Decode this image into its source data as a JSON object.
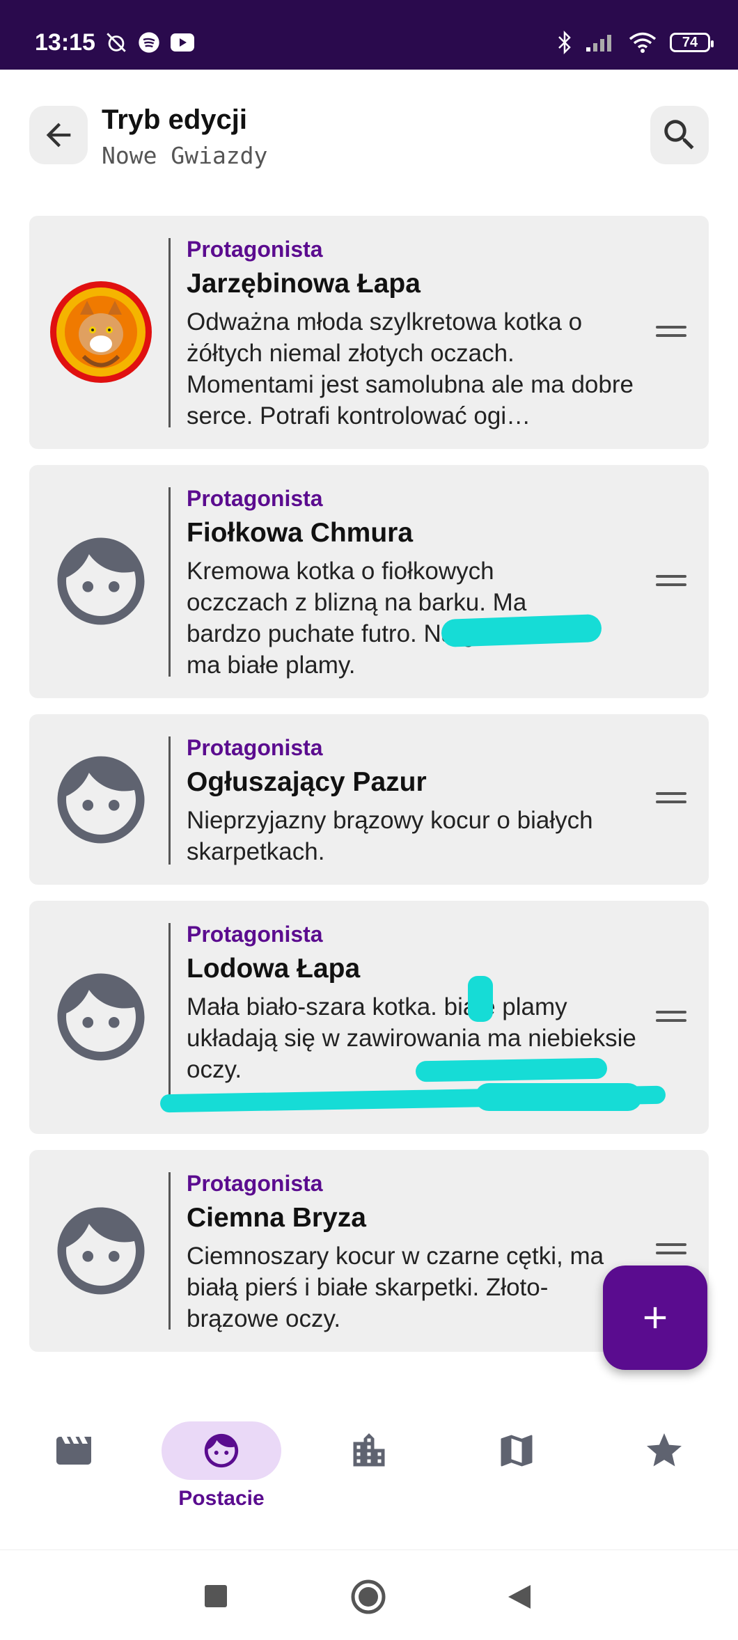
{
  "status_bar": {
    "time": "13:15",
    "battery": "74",
    "icons": [
      "alarm-off-icon",
      "spotify-icon",
      "youtube-icon",
      "bluetooth-icon",
      "signal-icon",
      "wifi-icon",
      "battery-icon"
    ]
  },
  "header": {
    "title": "Tryb edycji",
    "subtitle": "Nowe Gwiazdy"
  },
  "characters": [
    {
      "role": "Protagonista",
      "name": "Jarzębinowa Łapa",
      "description": "Odważna młoda szylkretowa kotka o żółtych niemal złotych oczach. Momentami jest samolubna ale ma dobre serce. Potrafi kontrolować ogi…"
    },
    {
      "role": "Protagonista",
      "name": "Fiołkowa Chmura",
      "description": "Kremowa kotka o fiołkowych oczczach z blizną na barku. Ma bardzo puchate futro. Na grzbiecie ma białe plamy."
    },
    {
      "role": "Protagonista",
      "name": "Ogłuszający Pazur",
      "description": "Nieprzyjazny brązowy kocur o białych skarpetkach."
    },
    {
      "role": "Protagonista",
      "name": "Lodowa Łapa",
      "description": "Mała biało-szara kotka. biale plamy układają się w zawirowania ma niebieksie oczy."
    },
    {
      "role": "Protagonista",
      "name": "Ciemna Bryza",
      "description": "Ciemnoszary kocur w czarne cętki, ma białą pierś i białe skarpetki. Złoto-brązowe oczy."
    }
  ],
  "bottom_nav": [
    {
      "icon": "clapperboard-icon",
      "label": ""
    },
    {
      "icon": "face-icon",
      "label": "Postacie",
      "active": true
    },
    {
      "icon": "city-icon",
      "label": ""
    },
    {
      "icon": "map-icon",
      "label": ""
    },
    {
      "icon": "star-icon",
      "label": ""
    }
  ],
  "colors": {
    "accent": "#5a0c8f",
    "status_bar": "#2a0a4d",
    "card_bg": "#efefef",
    "nav_active_bg": "#ead9f7",
    "marker": "#16dcd6"
  }
}
